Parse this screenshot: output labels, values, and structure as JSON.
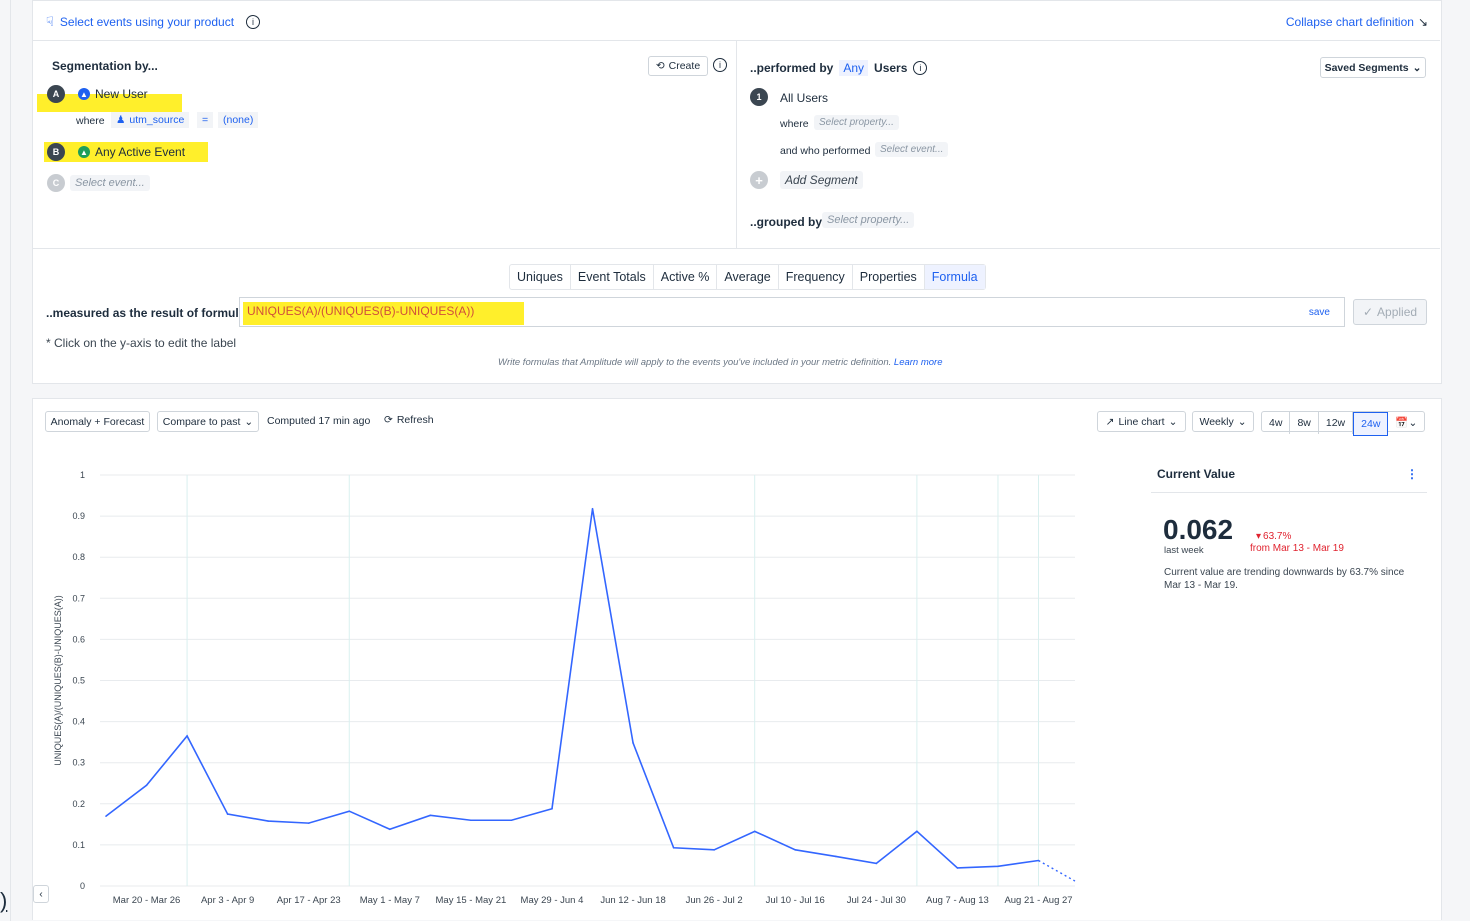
{
  "header": {
    "select_events_label": "Select events using your product",
    "collapse_label": "Collapse chart definition"
  },
  "segmentation": {
    "title": "Segmentation by...",
    "create_label": "Create",
    "events": [
      {
        "letter": "A",
        "name": "New User"
      },
      {
        "letter": "B",
        "name": "Any Active Event"
      },
      {
        "letter": "C",
        "name": "Select event..."
      }
    ],
    "where_label": "where",
    "where_property": "utm_source",
    "where_operator": "=",
    "where_value": "(none)"
  },
  "performed": {
    "prefix": "..performed by",
    "any_label": "Any",
    "users_label": "Users",
    "saved_segments_label": "Saved Segments",
    "segment_number": "1",
    "segment_name": "All Users",
    "where_label": "where",
    "where_placeholder": "Select property...",
    "who_performed_label": "and who performed",
    "who_performed_placeholder": "Select event...",
    "add_segment_label": "Add Segment",
    "grouped_by_label": "..grouped by",
    "grouped_by_placeholder": "Select property..."
  },
  "measure": {
    "tabs": [
      "Uniques",
      "Event Totals",
      "Active %",
      "Average",
      "Frequency",
      "Properties",
      "Formula"
    ],
    "active_tab": "Formula",
    "label": "..measured as the result of formula",
    "formula": "UNIQUES(A)/(UNIQUES(B)-UNIQUES(A))",
    "save_label": "save",
    "applied_label": "Applied",
    "note": "* Click on the y-axis to edit the label",
    "help_text": "Write formulas that Amplitude will apply to the events you've included in your metric definition.",
    "learn_more": "Learn more"
  },
  "toolbar": {
    "anomaly_label": "Anomaly + Forecast",
    "compare_label": "Compare to past",
    "computed_label": "Computed 17 min ago",
    "refresh_label": "Refresh",
    "chart_type_label": "Line chart",
    "interval_label": "Weekly",
    "ranges": [
      "4w",
      "8w",
      "12w",
      "24w"
    ],
    "active_range": "24w"
  },
  "current_value": {
    "title": "Current Value",
    "value": "0.062",
    "period": "last week",
    "change": "63.7%",
    "change_from": "from Mar 13 - Mar 19",
    "description": "Current value are trending downwards by 63.7% since Mar 13 - Mar 19."
  },
  "chart_data": {
    "type": "line",
    "ylabel": "UNIQUES(A)/(UNIQUES(B)-UNIQUES(A))",
    "ylim": [
      0,
      1
    ],
    "yticks": [
      "0",
      "0.1",
      "0.2",
      "0.3",
      "0.4",
      "0.5",
      "0.6",
      "0.7",
      "0.8",
      "0.9",
      "1"
    ],
    "x_tick_labels": [
      "Mar 20 - Mar 26",
      "Apr 3 - Apr 9",
      "Apr 17 - Apr 23",
      "May 1 - May 7",
      "May 15 - May 21",
      "May 29 - Jun 4",
      "Jun 12 - Jun 18",
      "Jun 26 - Jul 2",
      "Jul 10 - Jul 16",
      "Jul 24 - Jul 30",
      "Aug 7 - Aug 13",
      "Aug 21 - Aug 27"
    ],
    "series": [
      {
        "values": [
          0.17,
          0.245,
          0.365,
          0.175,
          0.158,
          0.153,
          0.182,
          0.138,
          0.172,
          0.16,
          0.16,
          0.188,
          0.918,
          0.348,
          0.093,
          0.088,
          0.133,
          0.088,
          0.072,
          0.055,
          0.133,
          0.044,
          0.048,
          0.062
        ],
        "projected": 0.012
      }
    ],
    "color": "#3366ff",
    "grid": true
  },
  "misc": {
    "left_mark": ")"
  }
}
